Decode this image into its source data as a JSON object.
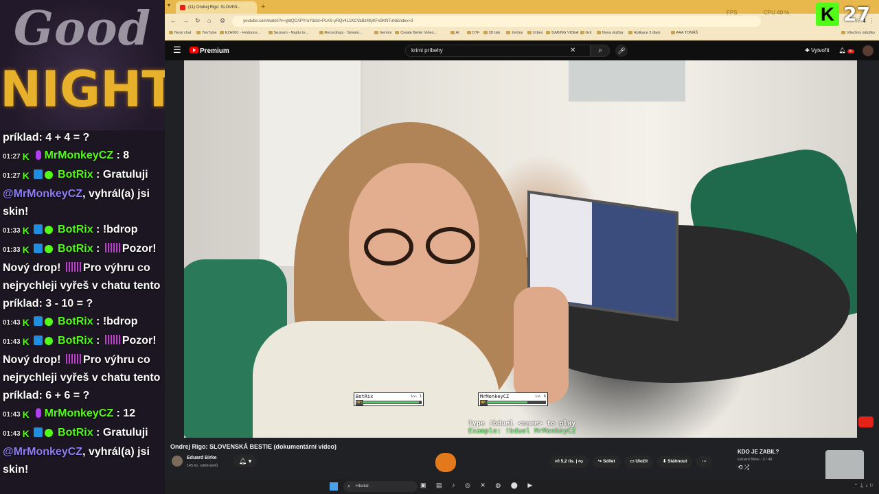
{
  "overlay": {
    "good": "Good",
    "night": "NIGHT",
    "kick_badge": "K",
    "viewer_count": "27",
    "fps_label": "FPS",
    "cpu_label": "CPU 40 %"
  },
  "chat": {
    "messages": [
      {
        "ts": "",
        "user": "",
        "text": "príklad: 4 + 4 = ?"
      },
      {
        "ts": "01:27",
        "user": "MrMonkeyCZ",
        "text": "8"
      },
      {
        "ts": "01:27",
        "user": "BotRix",
        "mention": "@MrMonkeyCZ",
        "text": "Gratuluji",
        "text2": ", vyhrál(a) jsi skin!"
      },
      {
        "ts": "01:33",
        "user": "BotRix",
        "text": "!bdrop"
      },
      {
        "ts": "01:33",
        "user": "BotRix",
        "text": "Pozor! Nový drop!",
        "text2": "Pro výhru co nejrychleji vyřeš v chatu tento príklad: 3 - 10 = ?"
      },
      {
        "ts": "01:43",
        "user": "BotRix",
        "text": "!bdrop"
      },
      {
        "ts": "01:43",
        "user": "BotRix",
        "text": "Pozor! Nový drop!",
        "text2": "Pro výhru co nejrychleji vyřeš v chatu tento príklad: 6 + 6 = ?"
      },
      {
        "ts": "01:43",
        "user": "MrMonkeyCZ",
        "text": "12"
      },
      {
        "ts": "01:43",
        "user": "BotRix",
        "mention": "@MrMonkeyCZ",
        "text": "Gratuluji",
        "text2": ", vyhrál(a) jsi skin!"
      }
    ]
  },
  "browser": {
    "tab_title": "(11) Ondrej Rigo: SLOVEN...",
    "new_tab": "+",
    "url": "youtube.com/watch?v=gtdQCAPYruY&list=PLKS-yRQv4L1KCVaBz4ltyKFx9KNTuN&index=3",
    "bookmarks": [
      "Nový chat",
      "YouTube",
      "KZH001 - Hodnoce...",
      "Seznam - Najdu to...",
      "Recordings - Stream...",
      "Gemini",
      "Create Better Video...",
      "AI",
      "DTF",
      "3D tisk",
      "žetóny",
      "Urbex",
      "DABING VIDEA",
      "Grit",
      "Nova služba",
      "Aplikace 3 dlani",
      "AAA TOMÁŠ",
      "Všechny záložky"
    ]
  },
  "youtube": {
    "logo": "Premium",
    "search_value": "krimi príbehy",
    "create_label": "Vytvořit",
    "notif_count": "9+",
    "video_title": "Ondrej Rigo: SLOVENSKÁ BESTIE (dokumentární video)",
    "channel_name": "Eduard Birke",
    "subscribers": "145 tis. odběratelů",
    "likes": "5,2 tis.",
    "share": "Sdílet",
    "save": "Uložit",
    "download": "Stáhnout",
    "playlist_title": "KDO JE ZABIL?",
    "playlist_sub": "Eduard Birke - 3 / 48"
  },
  "duel": {
    "left_name": "BotRix",
    "left_lv": "Lv. 1",
    "right_name": "MrMonkeyCZ",
    "right_lv": "Lv. 6",
    "hp_label": "HP:",
    "left_hp": 0.98,
    "right_hp": 0.7,
    "line1": "Type !bduel <name> to play",
    "line2": "Example: !bduel MrMonkeyCZ"
  },
  "taskbar": {
    "search_placeholder": "Hledat"
  }
}
